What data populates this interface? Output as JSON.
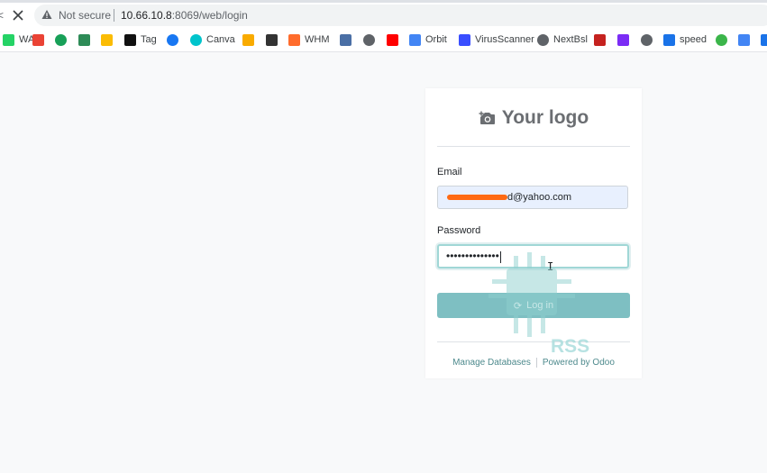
{
  "browser": {
    "back_fragment": "<",
    "stop_icon": "close-icon",
    "security_label": "Not secure",
    "url_host": "10.66.10.8",
    "url_rest": ":8069/web/login",
    "bookmarks": [
      {
        "label": "WA",
        "icon": "whatsapp-icon",
        "color": "#25d366"
      },
      {
        "label": "",
        "icon": "gmail-icon",
        "color": "#ea4335"
      },
      {
        "label": "",
        "icon": "green-circle-icon",
        "color": "#18a058"
      },
      {
        "label": "",
        "icon": "chip-icon",
        "color": "#2e8b57"
      },
      {
        "label": "",
        "icon": "google-ads-icon",
        "color": "#fbbc04"
      },
      {
        "label": "Tag",
        "icon": "r-icon",
        "color": "#111111"
      },
      {
        "label": "",
        "icon": "facebook-icon",
        "color": "#1877f2"
      },
      {
        "label": "Canva",
        "icon": "canva-icon",
        "color": "#00c4cc"
      },
      {
        "label": "",
        "icon": "analytics-icon",
        "color": "#f9ab00"
      },
      {
        "label": "",
        "icon": "panda-icon",
        "color": "#333333"
      },
      {
        "label": "WHM",
        "icon": "cpanel-icon",
        "color": "#ff6c2c"
      },
      {
        "label": "",
        "icon": "wifi-icon",
        "color": "#4a6fa5"
      },
      {
        "label": "",
        "icon": "globe-icon",
        "color": "#5f6368"
      },
      {
        "label": "",
        "icon": "youtube-icon",
        "color": "#ff0000"
      },
      {
        "label": "Orbit",
        "icon": "orbit-icon",
        "color": "#4285f4"
      },
      {
        "label": "VirusScanner",
        "icon": "virusscanner-icon",
        "color": "#394eff"
      },
      {
        "label": "NextBsl",
        "icon": "globe-icon",
        "color": "#5f6368"
      },
      {
        "label": "",
        "icon": "sigma-icon",
        "color": "#c5221f"
      },
      {
        "label": "",
        "icon": "pinwheel-icon",
        "color": "#7b2cf5"
      },
      {
        "label": "",
        "icon": "globe-icon",
        "color": "#5f6368"
      },
      {
        "label": "speed",
        "icon": "fiber-icon",
        "color": "#1a73e8"
      },
      {
        "label": "",
        "icon": "vp-icon",
        "color": "#3bb54a"
      },
      {
        "label": "",
        "icon": "translate-icon",
        "color": "#4285f4"
      },
      {
        "label": "",
        "icon": "square-icon",
        "color": "#1a73e8"
      }
    ]
  },
  "login": {
    "logo_icon": "camera-plus-icon",
    "logo_text": "Your logo",
    "email_label": "Email",
    "email_value": "d@yahoo.com",
    "password_label": "Password",
    "password_value": "••••••••••••••",
    "login_button": "Log in",
    "login_button_icon": "refresh-icon",
    "footer_manage": "Manage Databases",
    "footer_powered": "Powered by Odoo",
    "accent_color": "#7ebfc2"
  },
  "watermark": {
    "text": "RSS"
  }
}
